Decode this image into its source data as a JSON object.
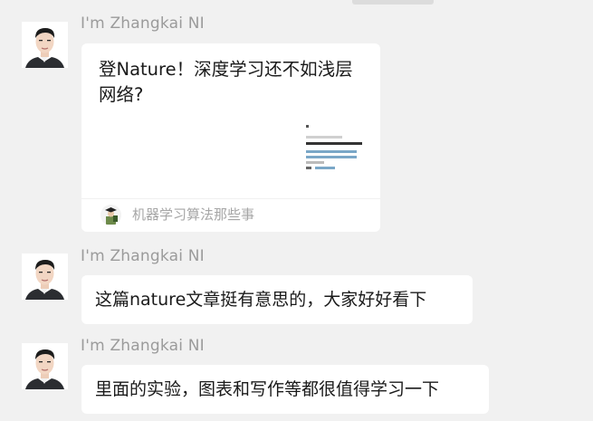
{
  "messages": [
    {
      "sender": "I'm Zhangkai NI",
      "type": "article-card",
      "card": {
        "title": "登Nature！深度学习还不如浅层网络?",
        "source": "机器学习算法那些事"
      }
    },
    {
      "sender": "I'm Zhangkai NI",
      "type": "text",
      "text": "这篇nature文章挺有意思的，大家好好看下"
    },
    {
      "sender": "I'm Zhangkai NI",
      "type": "text",
      "text": "里面的实验，图表和写作等都很值得学习一下"
    }
  ],
  "colors": {
    "background": "#f1f1f1",
    "bubble": "#ffffff",
    "sender_name": "#9b9b9b",
    "card_source": "#a6a6a6"
  },
  "icons": [
    "user-avatar-icon",
    "source-account-avatar-icon",
    "article-thumbnail"
  ]
}
